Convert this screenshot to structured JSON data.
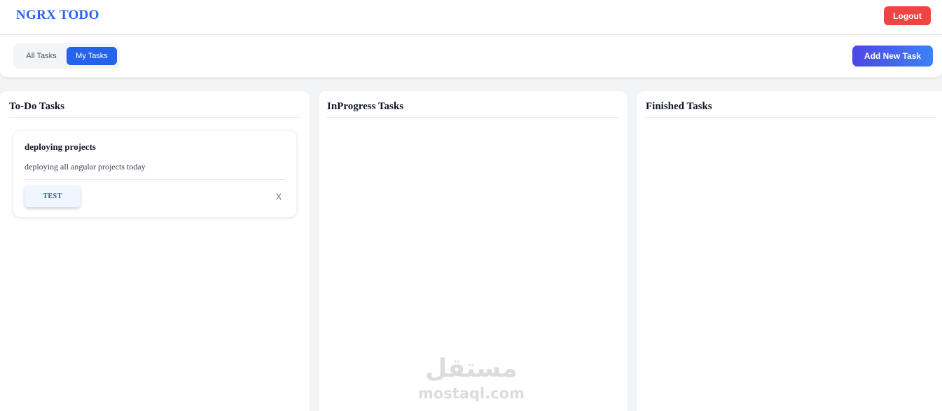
{
  "header": {
    "brand": "NGRX TODO",
    "logout_label": "Logout"
  },
  "toolbar": {
    "tabs": [
      {
        "label": "All Tasks",
        "active": false
      },
      {
        "label": "My Tasks",
        "active": true
      }
    ],
    "add_task_label": "Add New Task"
  },
  "columns": [
    {
      "title": "To-Do Tasks",
      "tasks": [
        {
          "title": "deploying projects",
          "description": "deploying all angular projects today",
          "tag": "TEST",
          "close_label": "X"
        }
      ]
    },
    {
      "title": "InProgress Tasks",
      "tasks": []
    },
    {
      "title": "Finished Tasks",
      "tasks": []
    }
  ],
  "watermark": {
    "arabic": "مستقل",
    "latin": "mostaql.com"
  },
  "colors": {
    "brand": "#2563eb",
    "logout": "#ef4444",
    "active_tab": "#2563eb",
    "add_button_start": "#4f46e5",
    "add_button_end": "#3b82f6",
    "tag_bg": "#eff6ff",
    "tag_text": "#1d4ed8"
  }
}
